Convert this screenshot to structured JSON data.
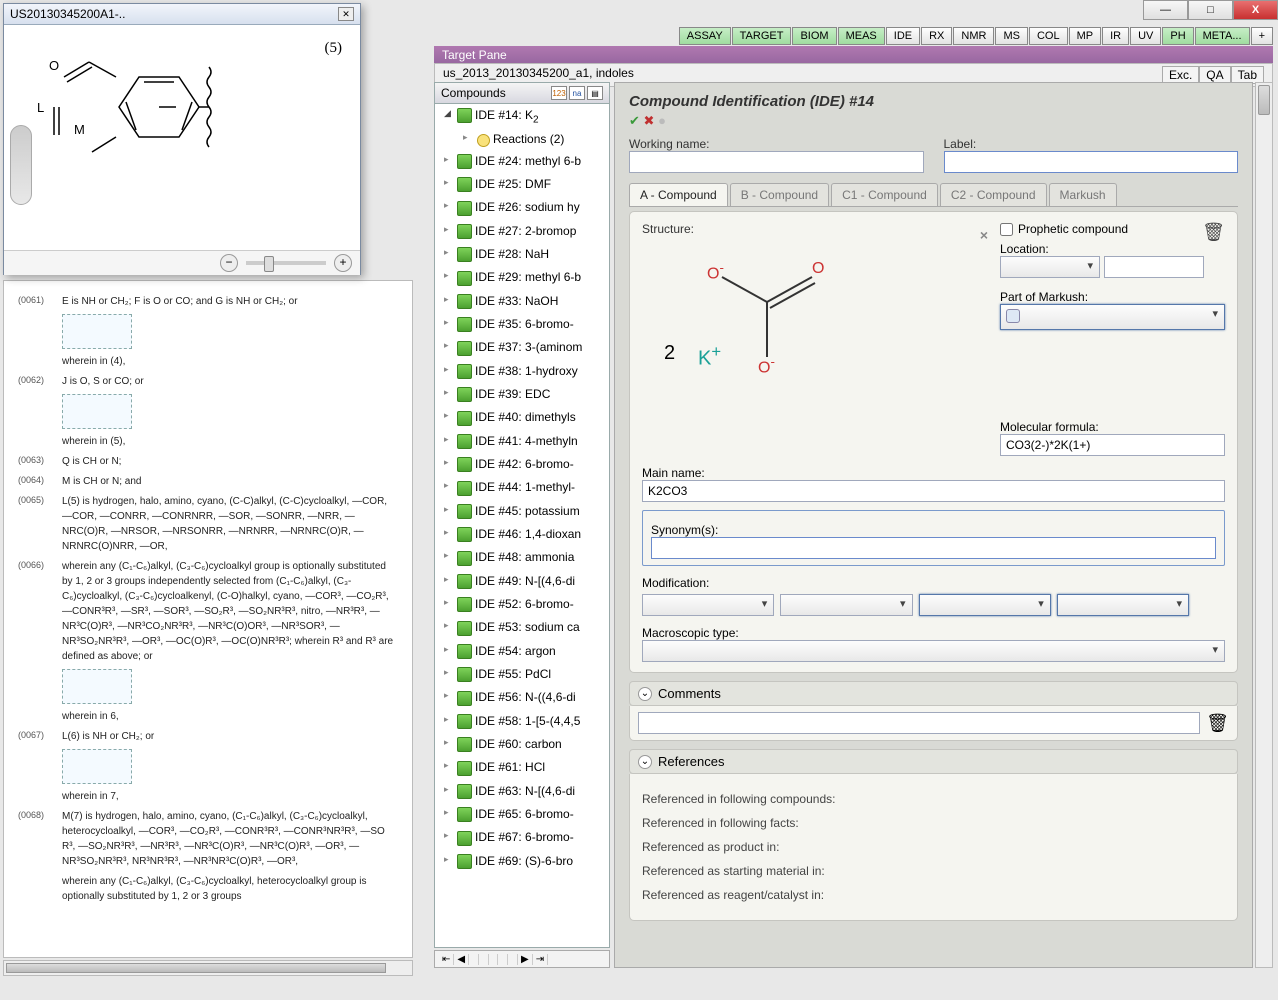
{
  "window_controls": {
    "min": "—",
    "max": "□",
    "close": "X"
  },
  "top_tabs": [
    "ASSAY",
    "TARGET",
    "BIOM",
    "MEAS",
    "IDE",
    "RX",
    "NMR",
    "MS",
    "COL",
    "MP",
    "IR",
    "UV",
    "PH",
    "META..."
  ],
  "top_tabs_plus": "+",
  "target_pane": "Target Pane",
  "doc_title": "us_2013_20130345200_a1, indoles",
  "doc_right_tabs": [
    "Exc.",
    "QA",
    "Tab"
  ],
  "compounds_header": "Compounds",
  "compounds": [
    "IDE #14: K<sub>2",
    "IDE #24: methyl 6-b",
    "IDE #25: DMF",
    "IDE #26: sodium hy",
    "IDE #27: 2-bromop",
    "IDE #28: NaH",
    "IDE #29: methyl 6-b",
    "IDE #33: NaOH",
    "IDE #35: 6-bromo-",
    "IDE #37: 3-(aminom",
    "IDE #38: 1-hydroxy",
    "IDE #39: EDC",
    "IDE #40: dimethyls",
    "IDE #41: 4-methyln",
    "IDE #42: 6-bromo-",
    "IDE #44: 1-methyl-",
    "IDE #45: potassium",
    "IDE #46: 1,4-dioxan",
    "IDE #48: ammonia",
    "IDE #49: N-[(4,6-di",
    "IDE #52: 6-bromo-",
    "IDE #53: sodium ca",
    "IDE #54: argon",
    "IDE #55: PdCl<sub",
    "IDE #56: N-((4,6-di",
    "IDE #58: 1-[5-(4,4,5",
    "IDE #60: carbon",
    "IDE #61: HCl",
    "IDE #63: N-[(4,6-di",
    "IDE #65: 6-bromo-",
    "IDE #67: 6-bromo-",
    "IDE #69: (S)-6-bro"
  ],
  "reactions_sub": "Reactions (2)",
  "form": {
    "title": "Compound Identification (IDE) #14",
    "working_name_label": "Working name:",
    "label_label": "Label:",
    "tabs": [
      "A - Compound",
      "B - Compound",
      "C1 - Compound",
      "C2 - Compound",
      "Markush"
    ],
    "structure_label": "Structure:",
    "prophetic": "Prophetic compound",
    "location_label": "Location:",
    "markush_label": "Part of Markush:",
    "molformula_label": "Molecular formula:",
    "molformula": "CO3(2-)*2K(1+)",
    "mainname_label": "Main name:",
    "mainname": "K2CO3",
    "synonyms_label": "Synonym(s):",
    "modification_label": "Modification:",
    "macro_label": "Macroscopic type:",
    "comments_label": "Comments",
    "references_label": "References",
    "refs": [
      "Referenced in following compounds:",
      "Referenced in following facts:",
      "Referenced as product in:",
      "Referenced as starting material in:",
      "Referenced as reagent/catalyst in:"
    ],
    "struct_k": "K",
    "struct_plus": "+",
    "struct_2": "2",
    "struct_o": "O"
  },
  "float_window": {
    "title": "US20130345200A1-..",
    "mol_label": "(5)",
    "atom_L": "L",
    "atom_M": "M",
    "atom_O": "O"
  },
  "doc_text": {
    "p1n": "(0061)",
    "p1": "E is NH or CH₂; F is O or CO; and G is NH or CH₂; or",
    "p2": "wherein in (4),",
    "p3n": "(0062)",
    "p3": "J is O, S or CO; or",
    "p4": "wherein in (5),",
    "p5n": "(0063)",
    "p5": "Q is CH or N;",
    "p6n": "(0064)",
    "p6": "M is CH or N; and",
    "p7n": "(0065)",
    "p7": "L(5) is hydrogen, halo, amino, cyano, (C-C)alkyl, (C-C)cycloalkyl, —COR, —COR, —CONRR, —CONRNRR, —SOR, —SONRR, —NRR, —NRC(O)R, —NRSOR, —NRSONRR, —NRNRR, —NRNRC(O)R, —NRNRC(O)NRR, —OR,",
    "p8n": "(0066)",
    "p8": "wherein any (C₁-C₆)alkyl, (C₃-C₆)cycloalkyl group is optionally substituted by 1, 2 or 3 groups independently selected from (C₁-C₆)alkyl, (C₃-C₆)cycloalkyl, (C₃-C₆)cycloalkenyl, (C-O)halkyl, cyano, —COR³, —CO₂R³, —CONR³R³, —SR³, —SOR³, —SO₂R³, —SO₂NR³R³, nitro, —NR³R³, —NR³C(O)R³, —NR³CO₂NR³R³, —NR³C(O)OR³, —NR³SOR³, —NR³SO₂NR³R³, —OR³, —OC(O)R³, —OC(O)NR³R³; wherein R³ and R³ are defined as above; or",
    "p9": "wherein in 6,",
    "p10n": "(0067)",
    "p10": "L(6) is NH or CH₂; or",
    "p11": "wherein in 7,",
    "p12n": "(0068)",
    "p12": "M(7) is hydrogen, halo, amino, cyano, (C₁-C₆)alkyl, (C₃-C₆)cycloalkyl, heterocycloalkyl, —COR³, —CO₂R³, —CONR³R³, —CONR³NR³R³, —SO R³, —SO₂NR³R³, —NR³R³, —NR³C(O)R³, —NR³C(O)R³, —OR³, —NR³SO₂NR³R³, NR³NR³R³, —NR³NR³C(O)R³, —OR³,",
    "p13": "wherein any (C₁-C₆)alkyl, (C₃-C₆)cycloalkyl, heterocycloalkyl group is optionally substituted by 1, 2 or 3 groups"
  }
}
